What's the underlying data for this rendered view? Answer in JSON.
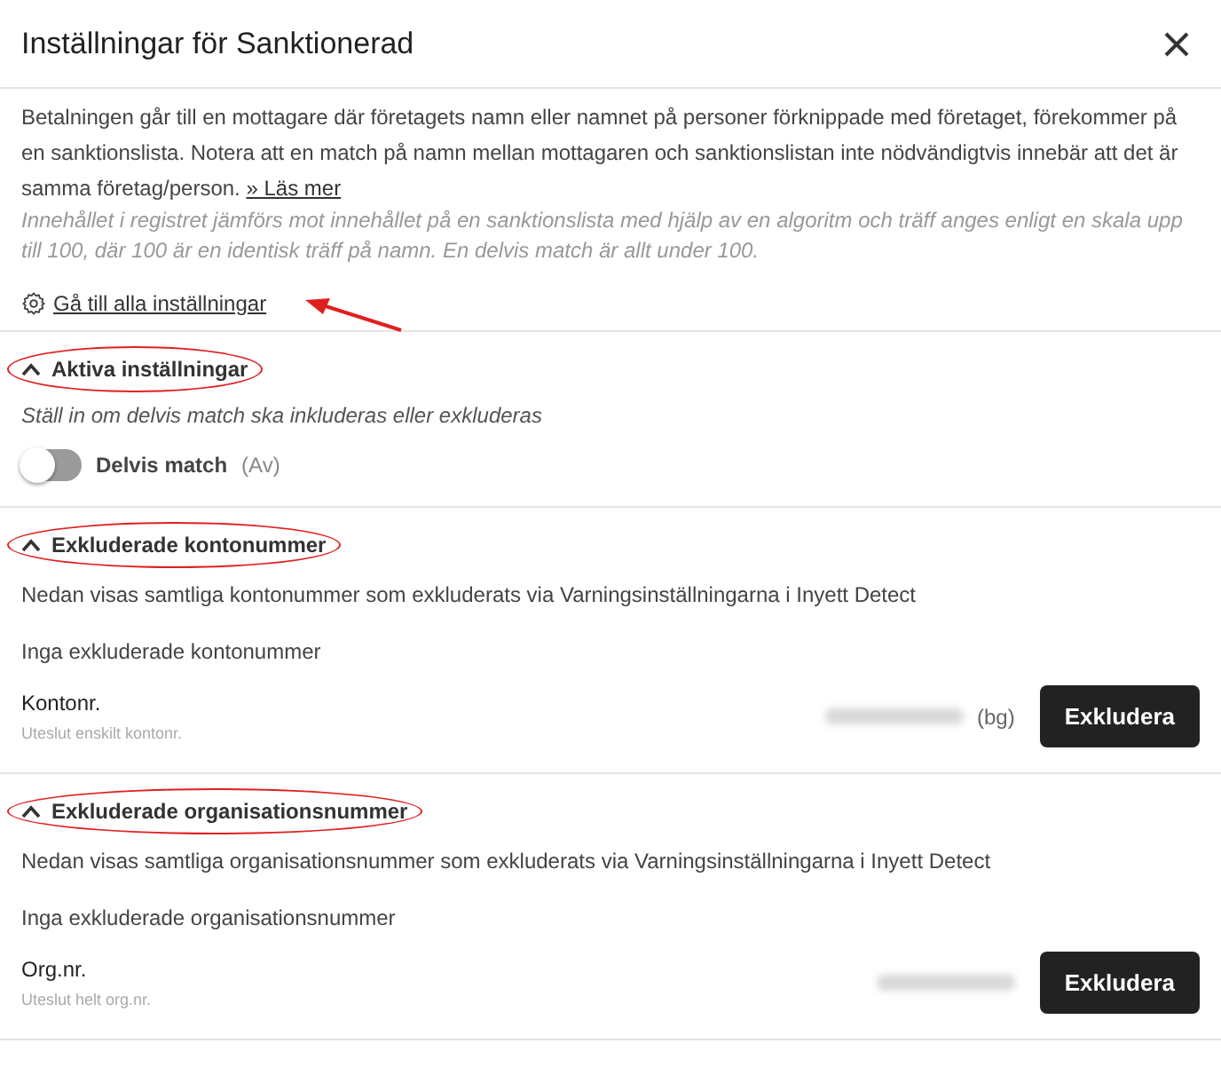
{
  "window": {
    "title": "Inställningar för Sanktionerad"
  },
  "intro": {
    "text": "Betalningen går till en mottagare där företagets namn eller namnet på personer förknippade med företaget, förekommer på en sanktionslista. Notera att en match på namn mellan mottagaren och sanktionslistan inte nödvändigtvis innebär att det är samma företag/person.",
    "link": "» Läs mer",
    "note": "Innehållet i registret jämförs mot innehållet på en sanktionslista med hjälp av en algoritm och träff anges enligt en skala upp till 100, där 100 är en identisk träff på namn. En delvis match är allt under 100.",
    "settings_link": "Gå till alla inställningar",
    "arrow_annotation": true
  },
  "sections": [
    {
      "kind": "toggle",
      "title": "Aktiva inställningar",
      "expanded": true,
      "highlighted": true,
      "hint": "Ställ in om delvis match ska inkluderas eller exkluderas",
      "toggle": {
        "label": "Delvis match",
        "state_text": "(Av)",
        "on": false
      }
    },
    {
      "kind": "exclude",
      "title": "Exkluderade kontonummer",
      "expanded": true,
      "highlighted": true,
      "description": "Nedan visas samtliga kontonummer som exkluderats via Varningsinställningarna i Inyett Detect",
      "empty_text": "Inga exkluderade kontonummer",
      "field_label": "Kontonr.",
      "field_hint": "Uteslut enskilt kontonr.",
      "suffix": "(bg)",
      "button": "Exkludera"
    },
    {
      "kind": "exclude",
      "title": "Exkluderade organisationsnummer",
      "expanded": true,
      "highlighted": true,
      "description": "Nedan visas samtliga organisationsnummer som exkluderats via Varningsinställningarna i Inyett Detect",
      "empty_text": "Inga exkluderade organisationsnummer",
      "field_label": "Org.nr.",
      "field_hint": "Uteslut helt org.nr.",
      "button": "Exkludera"
    }
  ]
}
